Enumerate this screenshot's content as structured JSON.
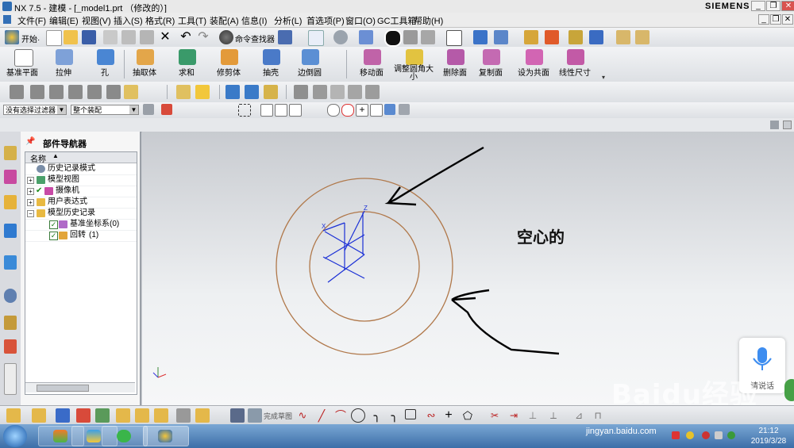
{
  "window": {
    "title": "NX 7.5 - 建模 - [_model1.prt （修改的）]",
    "brand": "SIEMENS",
    "minimize": "_",
    "restore": "❐",
    "close": "✕"
  },
  "menu": [
    "文件(F)",
    "编辑(E)",
    "视图(V)",
    "插入(S)",
    "格式(R)",
    "工具(T)",
    "装配(A)",
    "信息(I)",
    "分析(L)",
    "首选项(P)",
    "窗口(O)",
    "GC工具箱",
    "帮助(H)"
  ],
  "toolbar1": {
    "start_label": "开始·",
    "command_finder_label": "命令查找器"
  },
  "feature_toolbar": [
    "基准平面",
    "拉伸",
    "孔",
    "抽取体",
    "求和",
    "修剪体",
    "抽壳",
    "边倒圆"
  ],
  "sync_toolbar": [
    "移动面",
    "调整圆角大小",
    "删除面",
    "复制面",
    "设为共面",
    "线性尺寸"
  ],
  "selection": {
    "filter_value": "没有选择过滤器",
    "scope_value": "整个装配"
  },
  "navigator": {
    "title": "部件导航器",
    "column_header": "名称",
    "items": [
      {
        "label": "历史记录模式",
        "suffix": ""
      },
      {
        "label": "模型视图",
        "suffix": ""
      },
      {
        "label": "摄像机",
        "suffix": ""
      },
      {
        "label": "用户表达式",
        "suffix": ""
      },
      {
        "label": "模型历史记录",
        "suffix": ""
      },
      {
        "label": "基准坐标系",
        "suffix": "(0)"
      },
      {
        "label": "回转",
        "suffix": "(1)"
      }
    ]
  },
  "annotation": {
    "text": "空心的"
  },
  "triad": {
    "z_label": "Z",
    "x_label": "X",
    "y_label": "Y"
  },
  "sketch_toolbar": {
    "finish_sketch_label": "完成草图"
  },
  "voice_widget": {
    "label": "请说话"
  },
  "watermark": {
    "brand": "Baidu经验",
    "url": "jingyan.baidu.com"
  },
  "clock": {
    "time": "21:12",
    "date": "2019/3/28"
  },
  "colors": {
    "circle": "#b0784a",
    "triad": "#1a2fd6",
    "arrow": "#000000"
  }
}
